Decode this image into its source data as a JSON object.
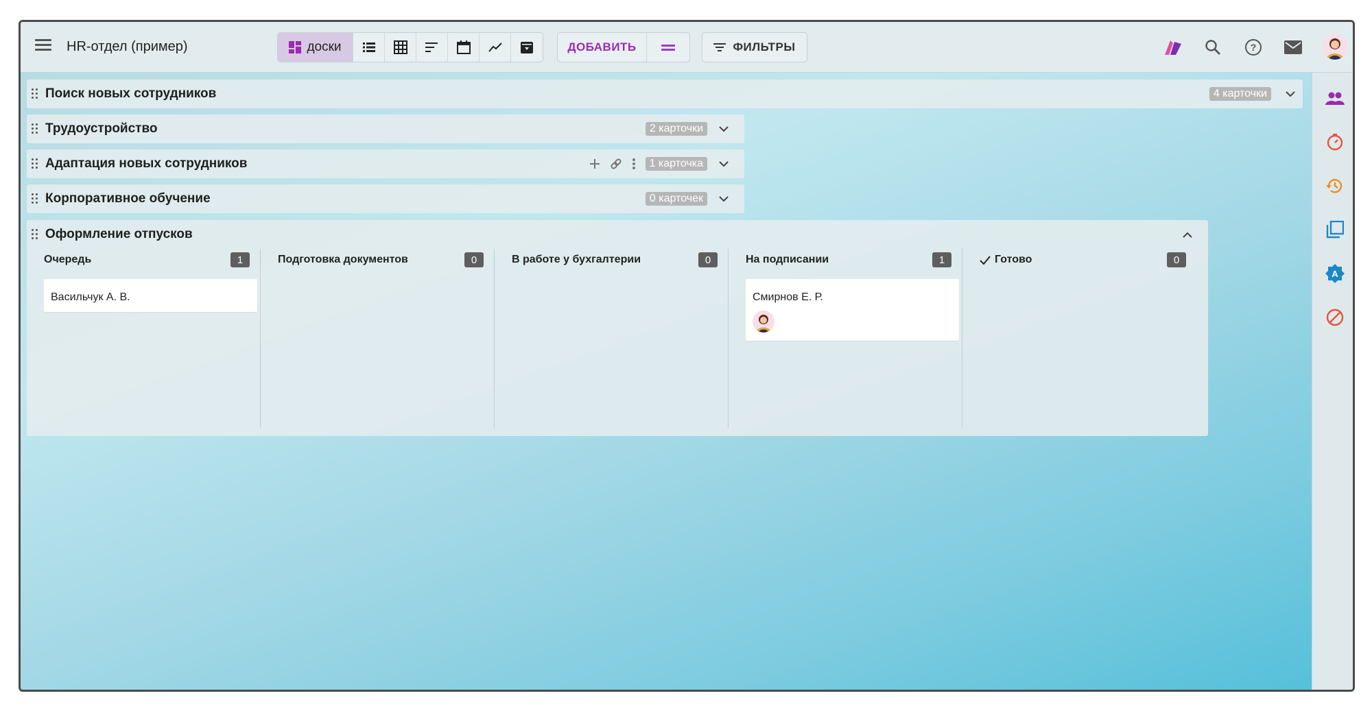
{
  "app": {
    "title": "HR-отдел (пример)"
  },
  "toolbar": {
    "views": [
      {
        "icon": "boards-icon",
        "label": "доски",
        "active": true
      },
      {
        "icon": "list-icon"
      },
      {
        "icon": "table-icon"
      },
      {
        "icon": "sort-icon"
      },
      {
        "icon": "calendar-icon"
      },
      {
        "icon": "chart-icon"
      },
      {
        "icon": "archive-icon"
      }
    ],
    "add_label": "ДОБАВИТЬ",
    "filter_label": "ФИЛЬТРЫ",
    "accent": "#9b2bb0"
  },
  "lanes": [
    {
      "title": "Поиск новых сотрудников",
      "count": "4 карточки"
    },
    {
      "title": "Трудоустройство",
      "count": "2 карточки"
    },
    {
      "title": "Адаптация новых сотрудников",
      "count": "1 карточка"
    },
    {
      "title": "Корпоративное обучение",
      "count": "0 карточек"
    }
  ],
  "board": {
    "title": "Оформление отпусков",
    "columns": [
      {
        "title": "Очередь",
        "count": "1",
        "cards": [
          {
            "title": "Васильчук А. В."
          }
        ]
      },
      {
        "title": "Подготовка документов",
        "count": "0",
        "cards": []
      },
      {
        "title": "В работе у бухгалтерии",
        "count": "0",
        "cards": []
      },
      {
        "title": "На подписании",
        "count": "1",
        "cards": [
          {
            "title": "Смирнов Е. Р.",
            "has_avatar": true
          }
        ]
      },
      {
        "title": "Готово",
        "count": "0",
        "done": true,
        "cards": []
      }
    ]
  },
  "sidebar_icons": [
    "users-icon",
    "timer-icon",
    "history-icon",
    "copy-icon",
    "badge-icon",
    "blocked-icon"
  ]
}
